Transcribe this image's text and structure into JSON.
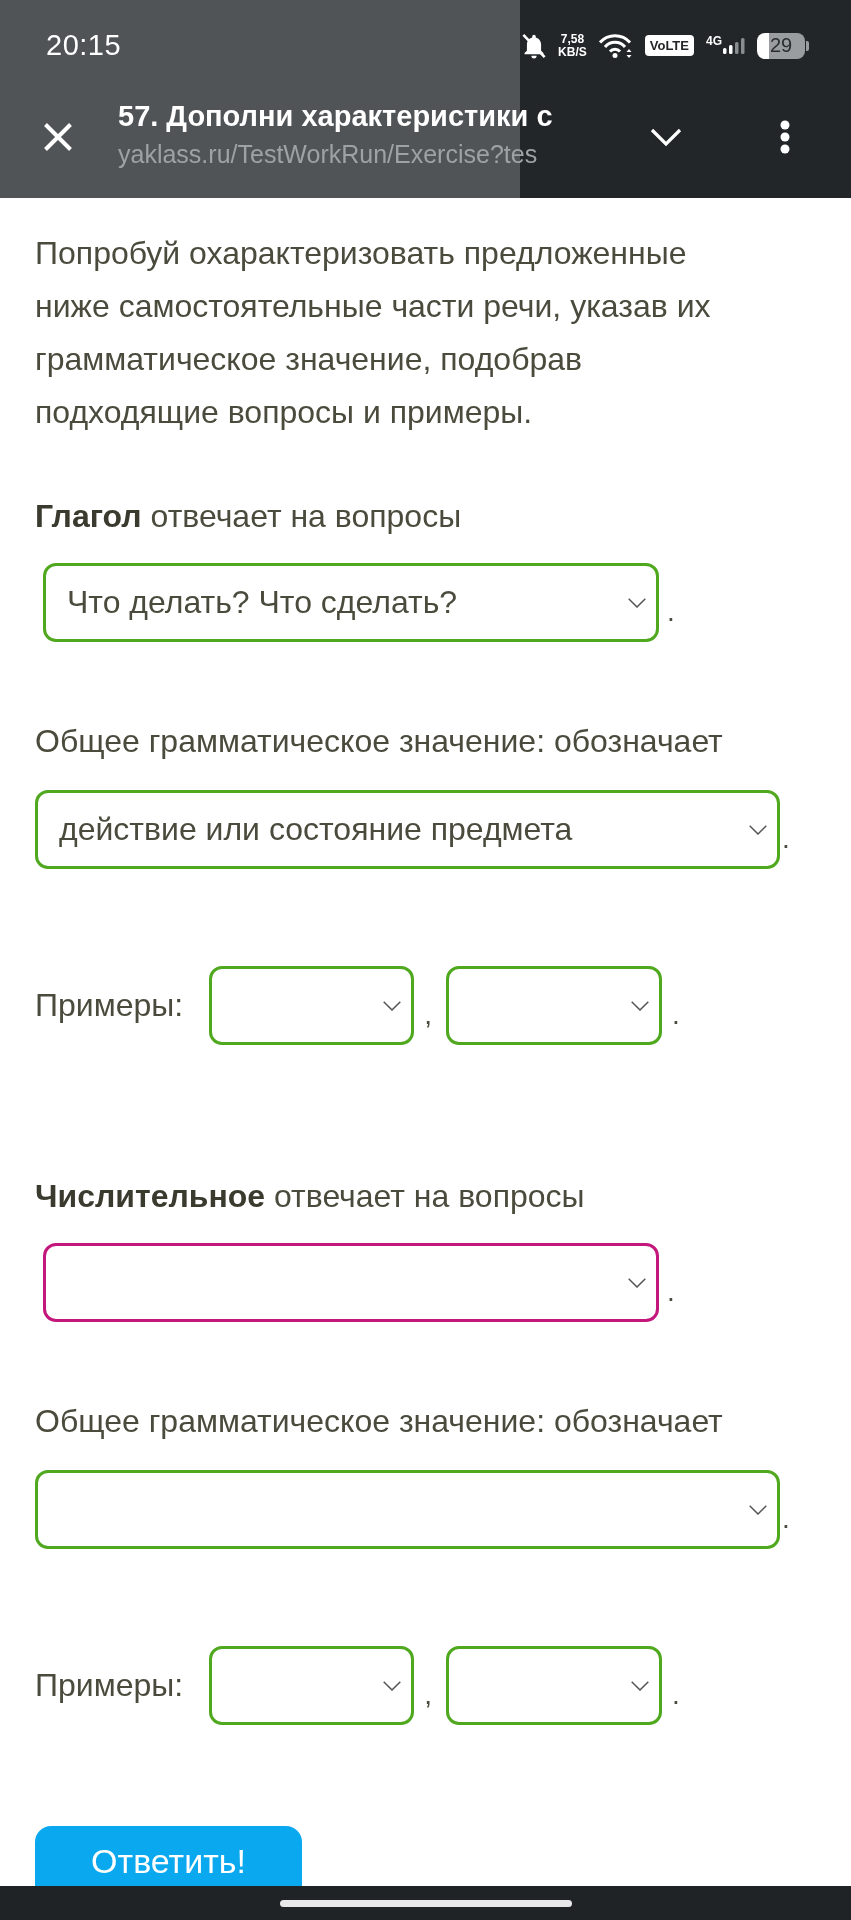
{
  "status_bar": {
    "time": "20:15",
    "speed_value": "7,58",
    "speed_unit": "KB/S",
    "volte": "VoLTE",
    "network_type": "4G",
    "battery": "29"
  },
  "header": {
    "title": "57. Дополни характеристики с",
    "url": "yaklass.ru/TestWorkRun/Exercise?tes"
  },
  "intro": "Попробуй охарактеризовать предложенные ниже самостоятельные части речи, указав их грамматическое значение, подобрав подходящие вопросы и примеры.",
  "sections": [
    {
      "prompt": "**Глагол** отвечает на вопросы",
      "question": {
        "value": "Что делать? Что сделать?",
        "color": "#4fa81e",
        "after": "."
      },
      "meaning_label": "Общее грамматическое значение: обозначает",
      "meaning": {
        "value": "действие или состояние предмета",
        "color": "#4fa81e",
        "after": "."
      },
      "examples_label": "Примеры:",
      "examples": [
        {
          "color": "#4fa81e",
          "after": ","
        },
        {
          "color": "#4fa81e",
          "after": "."
        }
      ]
    },
    {
      "prompt": "**Числительное** отвечает на вопросы",
      "question": {
        "color": "#c4177c",
        "after": "."
      },
      "meaning_label": "Общее грамматическое значение: обозначает",
      "meaning": {
        "color": "#4fa81e",
        "after": "."
      },
      "examples_label": "Примеры:",
      "examples": [
        {
          "color": "#4fa81e",
          "after": ","
        },
        {
          "color": "#4fa81e",
          "after": "."
        }
      ]
    }
  ],
  "submit_button": "Ответить!"
}
